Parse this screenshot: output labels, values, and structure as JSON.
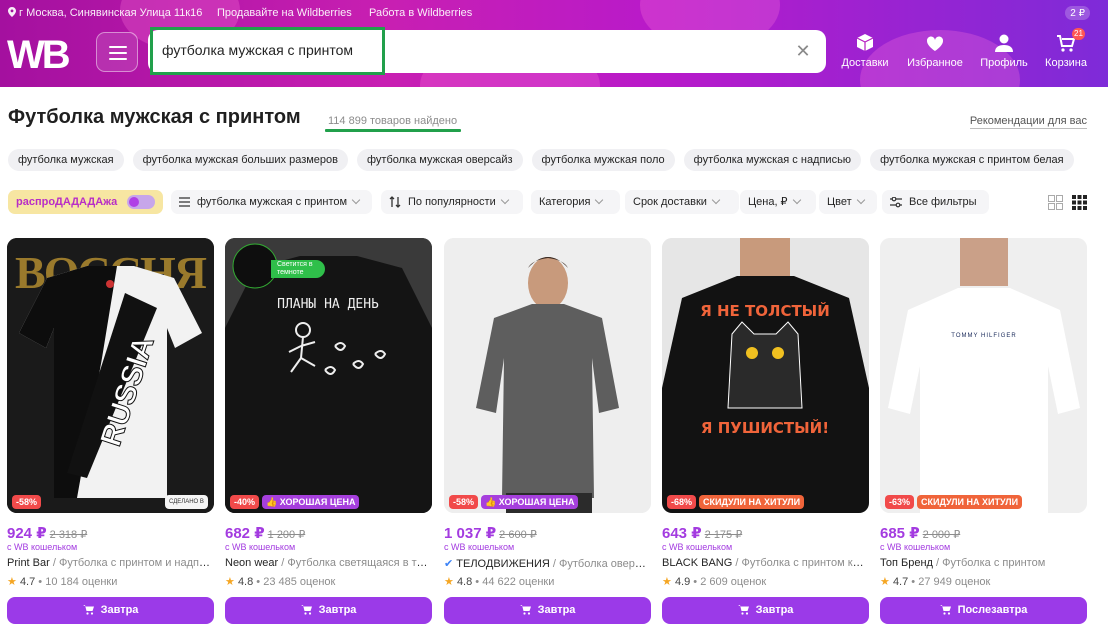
{
  "topbar": {
    "location": "г Москва, Синявинская Улица 11к16",
    "sell_link": "Продавайте на Wildberries",
    "work_link": "Работа в Wildberries",
    "wallet": "2 ₽"
  },
  "header": {
    "logo": "WB",
    "search_value": "футболка мужская с принтом",
    "nav": [
      {
        "label": "Доставки",
        "icon": "box-icon"
      },
      {
        "label": "Избранное",
        "icon": "heart-icon"
      },
      {
        "label": "Профиль",
        "icon": "user-icon"
      },
      {
        "label": "Корзина",
        "icon": "cart-icon",
        "badge": "21"
      }
    ]
  },
  "results": {
    "title": "Футболка мужская с принтом",
    "count": "114 899 товаров найдено",
    "recommendations": "Рекомендации для вас"
  },
  "chips": [
    "футболка мужская",
    "футболка мужская больших размеров",
    "футболка мужская оверсайз",
    "футболка мужская поло",
    "футболка мужская с надписью",
    "футболка мужская с принтом белая"
  ],
  "filters": {
    "promo": "распроДАДАДАжа",
    "category_query": "футболка мужская с принтом",
    "sort": "По популярности",
    "category": "Категория",
    "delivery": "Срок доставки",
    "price": "Цена, ₽",
    "color": "Цвет",
    "all": "Все фильтры"
  },
  "products": [
    {
      "price": "924 ₽",
      "old": "2 318 ₽",
      "wallet": "с WB кошельком",
      "brand": "Print Bar",
      "name": " / Футболка с принтом и надпис…",
      "rating": "4.7",
      "reviews": "10 184 оценки",
      "discount": "-58%",
      "label": "",
      "button": "Завтра",
      "image_text": "RUSSIA",
      "seal": "СДЕЛАНО В"
    },
    {
      "price": "682 ₽",
      "old": "1 200 ₽",
      "wallet": "с WB кошельком",
      "brand": "Neon wear",
      "name": " / Футболка светящаяся в те…",
      "rating": "4.8",
      "reviews": "23 485 оценок",
      "discount": "-40%",
      "label": "ХОРОШАЯ ЦЕНА",
      "button": "Завтра",
      "image_text": "ПЛАНЫ НА ДЕНЬ",
      "sticker": "Светится в темноте"
    },
    {
      "price": "1 037 ₽",
      "old": "2 600 ₽",
      "wallet": "с WB кошельком",
      "brand": "ТЕЛОДВИЖЕНИЯ",
      "name": " / Футболка оверса…",
      "rating": "4.8",
      "reviews": "44 622 оценки",
      "discount": "-58%",
      "label": "ХОРОШАЯ ЦЕНА",
      "button": "Завтра",
      "verified": true
    },
    {
      "price": "643 ₽",
      "old": "2 175 ₽",
      "wallet": "с WB кошельком",
      "brand": "BLACK BANG",
      "name": " / Футболка с принтом кот…",
      "rating": "4.9",
      "reviews": "2 609 оценок",
      "discount": "-68%",
      "label": "СКИДУЛИ НА ХИТУЛИ",
      "button": "Завтра",
      "image_text_1": "Я НЕ ТОЛСТЫЙ",
      "image_text_2": "Я ПУШИСТЫЙ!"
    },
    {
      "price": "685 ₽",
      "old": "2 000 ₽",
      "wallet": "с WB кошельком",
      "brand": "Топ Бренд",
      "name": " / Футболка с принтом",
      "rating": "4.7",
      "reviews": "27 949 оценок",
      "discount": "-63%",
      "label": "СКИДУЛИ НА ХИТУЛИ",
      "button": "Послезавтра",
      "image_text": "TOMMY HILFIGER"
    }
  ],
  "colors": {
    "accent": "#9b3ae8",
    "discount": "#f14a4a",
    "highlight": "#21a04b",
    "label_orange": "#f0643a"
  }
}
